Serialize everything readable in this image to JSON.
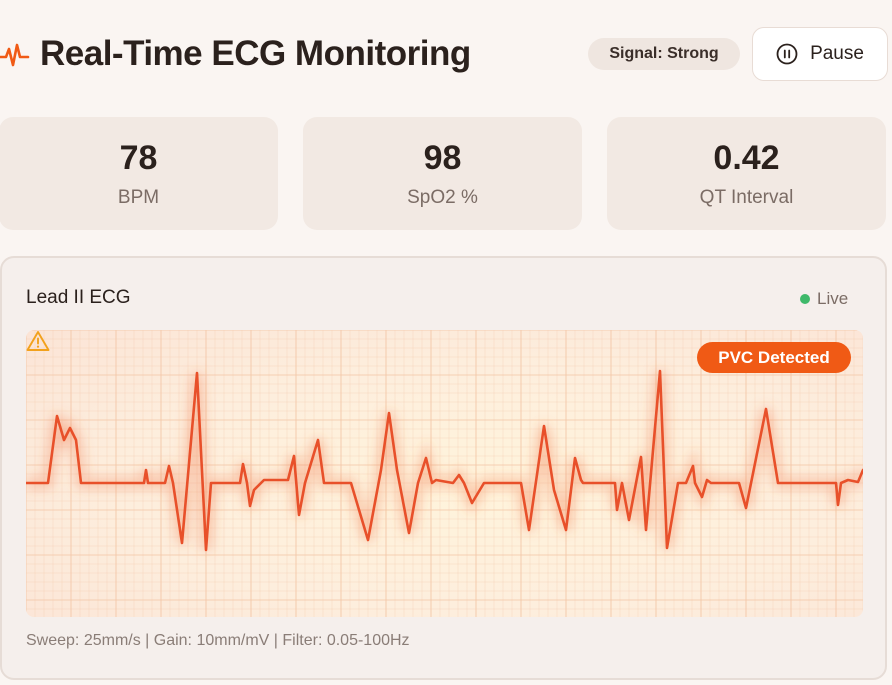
{
  "header": {
    "title": "Real-Time ECG Monitoring",
    "icon": "heartbeat-icon",
    "signal_badge": "Signal: Strong",
    "pause_label": "Pause",
    "pause_icon": "pause-icon"
  },
  "stats": [
    {
      "value": "78",
      "label": "BPM"
    },
    {
      "value": "98",
      "label": "SpO2 %"
    },
    {
      "value": "0.42",
      "label": "QT Interval"
    }
  ],
  "ecg_panel": {
    "title": "Lead II ECG",
    "live_label": "Live",
    "alert_label": "PVC Detected",
    "alert_icon": "warning-icon",
    "footer": "Sweep: 25mm/s | Gain: 10mm/mV | Filter: 0.05-100Hz"
  },
  "colors": {
    "accent": "#f05a15",
    "trace": "#e8502a",
    "live": "#3fb96a",
    "grid": "#f3c7a8"
  }
}
